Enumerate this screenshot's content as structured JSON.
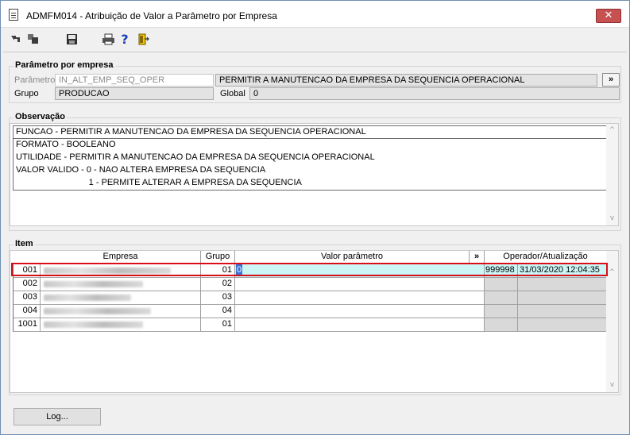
{
  "window": {
    "title": "ADMFM014 - Atribuição de Valor a Parâmetro por Empresa",
    "close_glyph": "✕"
  },
  "toolbar": {
    "icons": [
      "navigate-back-icon",
      "navigate-forward-icon",
      "save-icon",
      "print-icon",
      "help-icon",
      "exit-icon"
    ],
    "help_glyph": "?"
  },
  "parametro_group": {
    "title": "Parâmetro por empresa",
    "parametro_label": "Parâmetro",
    "parametro_value": "IN_ALT_EMP_SEQ_OPER",
    "parametro_desc": "PERMITIR A MANUTENCAO DA EMPRESA DA SEQUENCIA OPERACIONAL",
    "more_button": "»",
    "grupo_label": "Grupo",
    "grupo_value": "PRODUCAO",
    "global_label": "Global",
    "global_value": "0"
  },
  "observacao": {
    "title": "Observação",
    "lines": [
      "FUNCAO -  PERMITIR A MANUTENCAO DA EMPRESA DA SEQUENCIA OPERACIONAL",
      "FORMATO - BOOLEANO",
      "UTILIDADE -  PERMITIR A MANUTENCAO DA EMPRESA DA SEQUENCIA OPERACIONAL",
      "VALOR VALIDO - 0 - NAO ALTERA EMPRESA DA SEQUENCIA",
      "                              1 - PERMITE ALTERAR A EMPRESA DA SEQUENCIA"
    ]
  },
  "item": {
    "title": "Item",
    "headers": {
      "empresa": "Empresa",
      "grupo": "Grupo",
      "valor": "Valor parâmetro",
      "more": "»",
      "operador": "Operador/Atualização"
    },
    "rows": [
      {
        "code": "001",
        "grupo": "01",
        "valor": "0",
        "operador": "999998",
        "atualizacao": "31/03/2020 12:04:35"
      },
      {
        "code": "002",
        "grupo": "02",
        "valor": "",
        "operador": "",
        "atualizacao": ""
      },
      {
        "code": "003",
        "grupo": "03",
        "valor": "",
        "operador": "",
        "atualizacao": ""
      },
      {
        "code": "004",
        "grupo": "04",
        "valor": "",
        "operador": "",
        "atualizacao": ""
      },
      {
        "code": "1001",
        "grupo": "01",
        "valor": "",
        "operador": "",
        "atualizacao": ""
      }
    ]
  },
  "footer": {
    "log_button": "Log..."
  },
  "colors": {
    "selected_row": "#ccf6f6",
    "selection_outline": "#d6101a",
    "title_close": "#c75050"
  }
}
